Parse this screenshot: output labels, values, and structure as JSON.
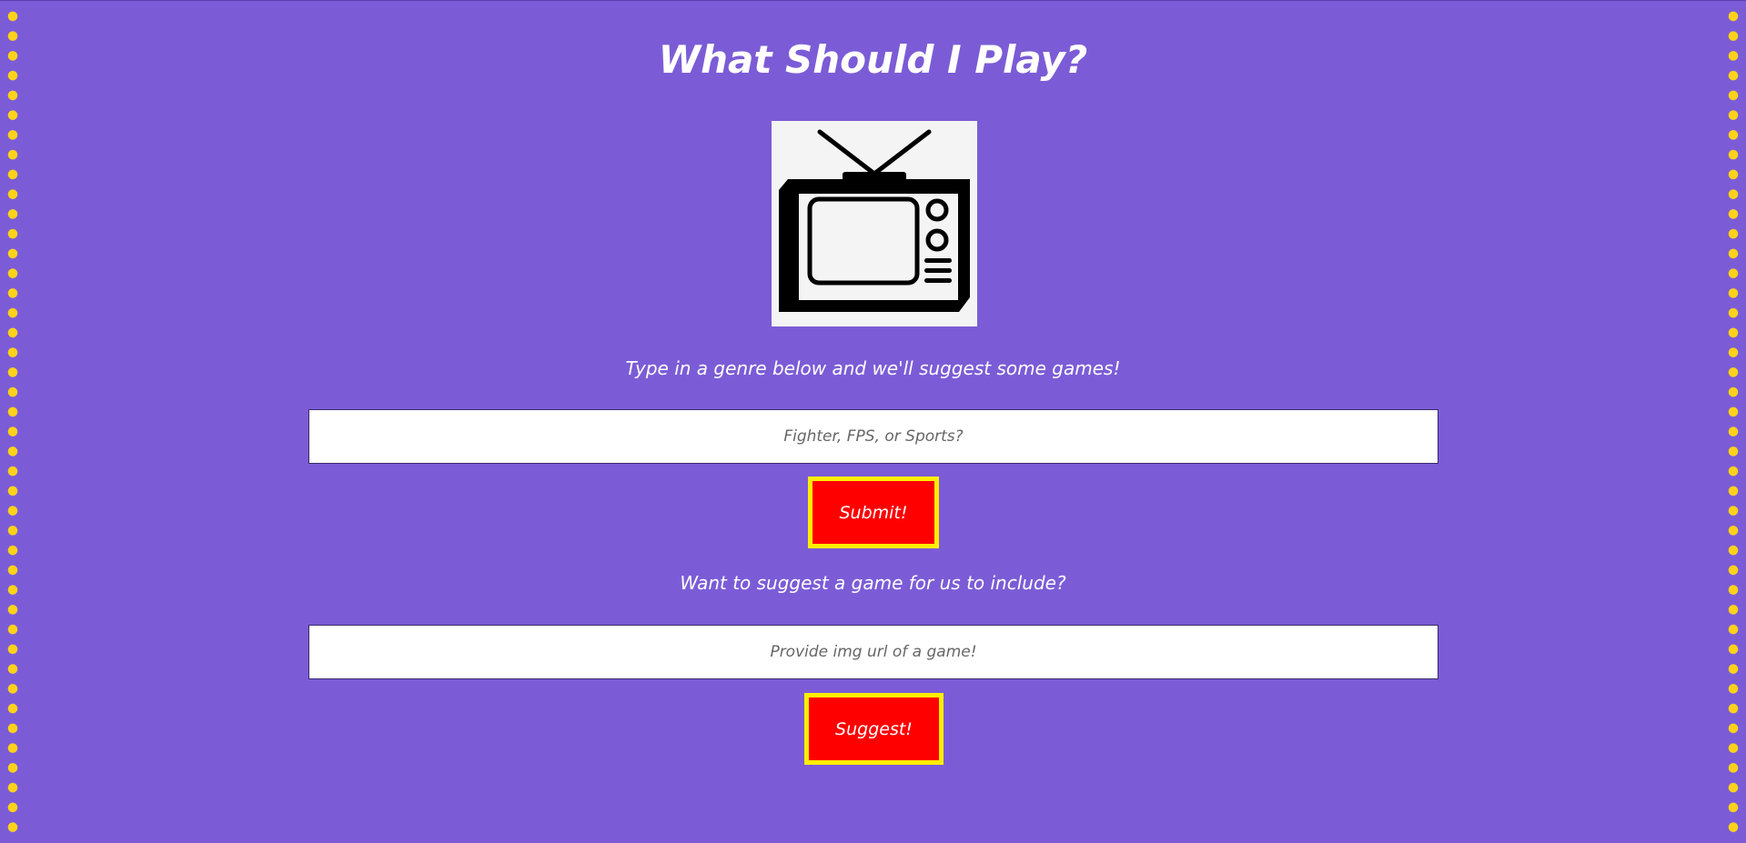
{
  "title": "What Should I Play?",
  "image": {
    "icon": "retro-tv-icon",
    "background": "#f4f4f4"
  },
  "genre_section": {
    "prompt": "Type in a genre below and we'll suggest some games!",
    "placeholder": "Fighter, FPS, or Sports?",
    "value": "",
    "button_label": "Submit!"
  },
  "suggest_section": {
    "prompt": "Want to suggest a game for us to include?",
    "placeholder": "Provide img url of a game!",
    "value": "",
    "button_label": "Suggest!"
  },
  "colors": {
    "background": "#7b5cd6",
    "dots": "#ffd21a",
    "button": "#ff0000",
    "button_border": "#ffee00",
    "text": "#ffffff"
  }
}
